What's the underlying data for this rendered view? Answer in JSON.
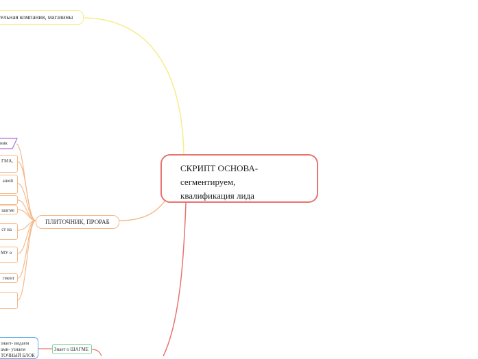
{
  "central": {
    "lines": [
      "СКРИПТ ОСНОВА-",
      "сегментируем,",
      "квалификация лида"
    ],
    "color": "#e9736f"
  },
  "top_branch": {
    "label": "тельная компания, магазины",
    "color": "#f7ec8a"
  },
  "mid_branch": {
    "label": "ПЛИТОЧНИК, ПРОРАБ",
    "color": "#f5b98a",
    "children": [
      {
        "lines": [
          "ник"
        ],
        "style": "parallelogram",
        "color": "#b06fd8"
      },
      {
        "lines": [
          "ГМА,",
          ""
        ],
        "style": "box"
      },
      {
        "lines": [
          "ашей",
          ""
        ],
        "style": "box"
      },
      {
        "lines": [
          "",
          ""
        ],
        "style": "box"
      },
      {
        "lines": [
          "шагме"
        ],
        "style": "box"
      },
      {
        "lines": [
          "ст на",
          ""
        ],
        "style": "box"
      },
      {
        "lines": [
          "МУ в",
          ""
        ],
        "style": "box"
      },
      {
        "lines": [
          "гмент"
        ],
        "style": "box"
      },
      {
        "lines": [
          "",
          ""
        ],
        "style": "box"
      }
    ]
  },
  "bottom_branch": {
    "label": "Знает о ШАГМЕ",
    "color": "#7fd49a",
    "child_lines": [
      "знает- видаем",
      "ами- узнаем",
      "ТОЧНЫЙ БЛОК"
    ],
    "child_color": "#5aa9e6"
  }
}
